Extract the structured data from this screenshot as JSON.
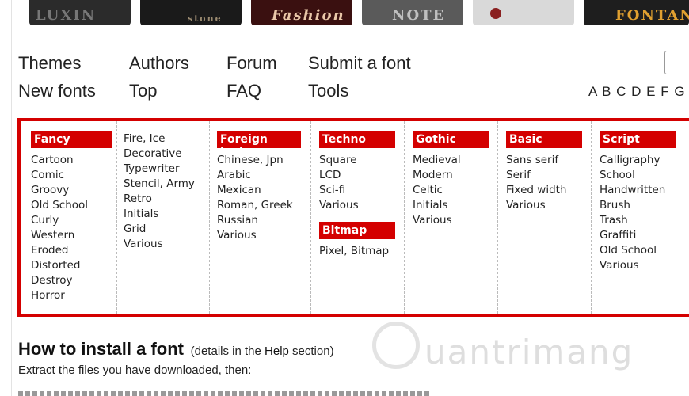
{
  "banner": {
    "thumbs": [
      "LUXIN",
      "stone",
      "Fashion",
      "NOTE",
      "",
      "FONTANE"
    ]
  },
  "nav": {
    "row1": [
      "Themes",
      "Authors",
      "Forum",
      "Submit a font"
    ],
    "row2": [
      "New fonts",
      "Top",
      "FAQ",
      "Tools"
    ],
    "letters": "A B C D E F G"
  },
  "categories": [
    {
      "header": "Fancy",
      "items": [
        "Cartoon",
        "Comic",
        "Groovy",
        "Old School",
        "Curly",
        "Western",
        "Eroded",
        "Distorted",
        "Destroy",
        "Horror"
      ]
    },
    {
      "header": "",
      "items": [
        "Fire, Ice",
        "Decorative",
        "Typewriter",
        "Stencil, Army",
        "Retro",
        "Initials",
        "Grid",
        "Various"
      ]
    },
    {
      "header": "Foreign look",
      "items": [
        "Chinese, Jpn",
        "Arabic",
        "Mexican",
        "Roman, Greek",
        "Russian",
        "Various"
      ]
    },
    {
      "header": "Techno",
      "items": [
        "Square",
        "LCD",
        "Sci-fi",
        "Various"
      ],
      "sub_header": "Bitmap",
      "sub_items": [
        "Pixel, Bitmap"
      ]
    },
    {
      "header": "Gothic",
      "items": [
        "Medieval",
        "Modern",
        "Celtic",
        "Initials",
        "Various"
      ]
    },
    {
      "header": "Basic",
      "items": [
        "Sans serif",
        "Serif",
        "Fixed width",
        "Various"
      ]
    },
    {
      "header": "Script",
      "items": [
        "Calligraphy",
        "School",
        "Handwritten",
        "Brush",
        "Trash",
        "Graffiti",
        "Old School",
        "Various"
      ]
    }
  ],
  "install": {
    "title": "How to install a font",
    "details_prefix": "(details in the ",
    "details_link": "Help",
    "details_suffix": " section)",
    "extract_text": "Extract the files you have downloaded, then:"
  },
  "watermark": {
    "text": "uantrimang"
  },
  "colors": {
    "accent": "#d40000"
  }
}
